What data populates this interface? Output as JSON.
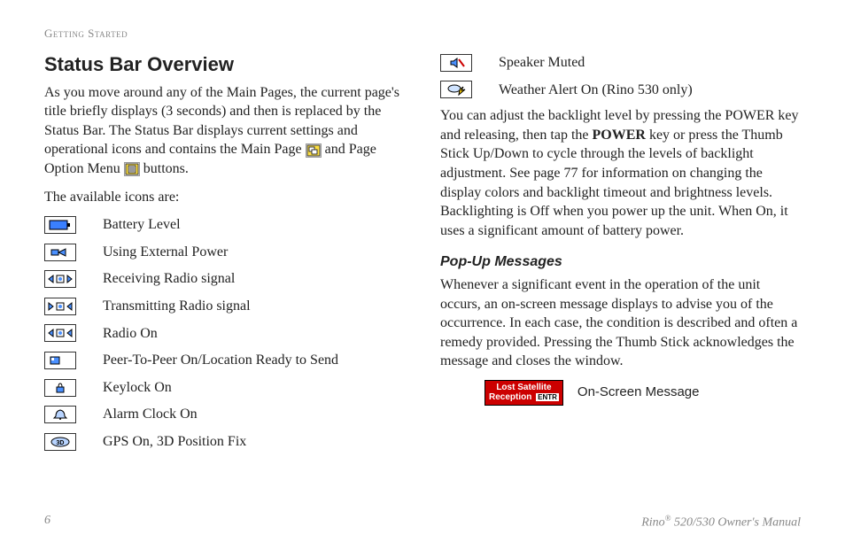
{
  "header": {
    "section_label": "Getting Started"
  },
  "left": {
    "heading": "Status Bar Overview",
    "intro_prefix": "As you move around any of the Main Pages, the current page's title briefly displays (3 seconds) and then is replaced by the Status Bar. The Status Bar displays current settings and operational icons and contains the Main Page ",
    "intro_mid": " and Page Option Menu ",
    "intro_suffix": " buttons.",
    "available_label": "The available icons are:",
    "icons": [
      {
        "name": "battery-level-icon",
        "label": "Battery Level"
      },
      {
        "name": "external-power-icon",
        "label": "Using External Power"
      },
      {
        "name": "receiving-radio-icon",
        "label": "Receiving Radio signal"
      },
      {
        "name": "transmitting-radio-icon",
        "label": "Transmitting Radio signal"
      },
      {
        "name": "radio-on-icon",
        "label": "Radio On"
      },
      {
        "name": "peer-to-peer-icon",
        "label": "Peer-To-Peer On/Location Ready to Send"
      },
      {
        "name": "keylock-icon",
        "label": "Keylock On"
      },
      {
        "name": "alarm-clock-icon",
        "label": "Alarm Clock On"
      },
      {
        "name": "gps-3d-icon",
        "label": "GPS On, 3D Position Fix"
      }
    ]
  },
  "right": {
    "extra_icons": [
      {
        "name": "speaker-muted-icon",
        "label": "Speaker Muted"
      },
      {
        "name": "weather-alert-icon",
        "label": "Weather Alert On (Rino 530 only)"
      }
    ],
    "backlight_p1_a": "You can adjust the backlight level by pressing the POWER key and releasing, then tap the ",
    "backlight_bold": "POWER",
    "backlight_p1_b": " key or press the Thumb Stick Up/Down to cycle through the levels of backlight adjustment. See page 77 for information on changing the display colors and backlight timeout and brightness levels. Backlighting is Off when you power up the unit. When On, it uses a significant amount of battery power.",
    "popup_heading": "Pop-Up Messages",
    "popup_body": "Whenever a significant event in the operation of the unit occurs, an on-screen message displays to advise you of the occurrence. In each case, the condition is described and often a remedy provided. Pressing the Thumb Stick acknowledges the message and closes the window.",
    "onscreen_msg_line1": "Lost Satellite",
    "onscreen_msg_line2": "Reception",
    "onscreen_msg_entr": "ENTR",
    "onscreen_label": "On-Screen Message"
  },
  "footer": {
    "page": "6",
    "manual_a": "Rino",
    "manual_sup": "®",
    "manual_b": " 520/530 Owner's Manual"
  }
}
